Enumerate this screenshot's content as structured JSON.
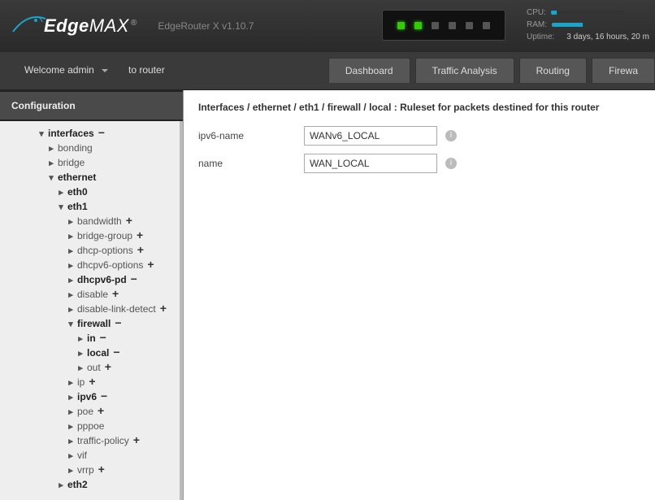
{
  "header": {
    "brand": "EdgeMAX",
    "reg": "®",
    "product": "EdgeRouter X v1.10.7",
    "sys": {
      "cpu_label": "CPU:",
      "cpu_pct": 8,
      "ram_label": "RAM:",
      "ram_pct": 42,
      "uptime_label": "Uptime:",
      "uptime_value": "3 days, 16 hours, 20 m"
    },
    "leds": [
      true,
      true,
      false,
      false,
      false,
      false
    ]
  },
  "row2": {
    "welcome": "Welcome admin",
    "torouter": "to router",
    "tabs": [
      "Dashboard",
      "Traffic Analysis",
      "Routing",
      "Firewa"
    ]
  },
  "sidebar": {
    "title": "Configuration",
    "tree": {
      "interfaces": {
        "label": "interfaces",
        "expand": "−",
        "bold": true
      },
      "bonding": {
        "label": "bonding"
      },
      "bridge": {
        "label": "bridge"
      },
      "ethernet": {
        "label": "ethernet",
        "bold": true
      },
      "eth0": {
        "label": "eth0",
        "bold": true
      },
      "eth1": {
        "label": "eth1",
        "bold": true
      },
      "bandwidth": {
        "label": "bandwidth",
        "expand": "+"
      },
      "bridgegroup": {
        "label": "bridge-group",
        "expand": "+"
      },
      "dhcpoptions": {
        "label": "dhcp-options",
        "expand": "+"
      },
      "dhcpv6options": {
        "label": "dhcpv6-options",
        "expand": "+"
      },
      "dhcpv6pd": {
        "label": "dhcpv6-pd",
        "expand": "−",
        "bold": true
      },
      "disable": {
        "label": "disable",
        "expand": "+"
      },
      "disablelink": {
        "label": "disable-link-detect",
        "expand": "+"
      },
      "firewall": {
        "label": "firewall",
        "expand": "−",
        "bold": true
      },
      "fw_in": {
        "label": "in",
        "expand": "−",
        "bold": true
      },
      "fw_local": {
        "label": "local",
        "expand": "−",
        "bold": true
      },
      "fw_out": {
        "label": "out",
        "expand": "+"
      },
      "ip": {
        "label": "ip",
        "expand": "+"
      },
      "ipv6": {
        "label": "ipv6",
        "expand": "−",
        "bold": true
      },
      "poe": {
        "label": "poe",
        "expand": "+"
      },
      "pppoe": {
        "label": "pppoe"
      },
      "trafficpolicy": {
        "label": "traffic-policy",
        "expand": "+"
      },
      "vif": {
        "label": "vif"
      },
      "vrrp": {
        "label": "vrrp",
        "expand": "+"
      },
      "eth2": {
        "label": "eth2",
        "bold": true
      }
    }
  },
  "main": {
    "breadcrumb": "Interfaces / ethernet / eth1 / firewall / local : Ruleset for packets destined for this router",
    "fields": {
      "ipv6name": {
        "label": "ipv6-name",
        "value": "WANv6_LOCAL"
      },
      "name": {
        "label": "name",
        "value": "WAN_LOCAL"
      }
    }
  }
}
